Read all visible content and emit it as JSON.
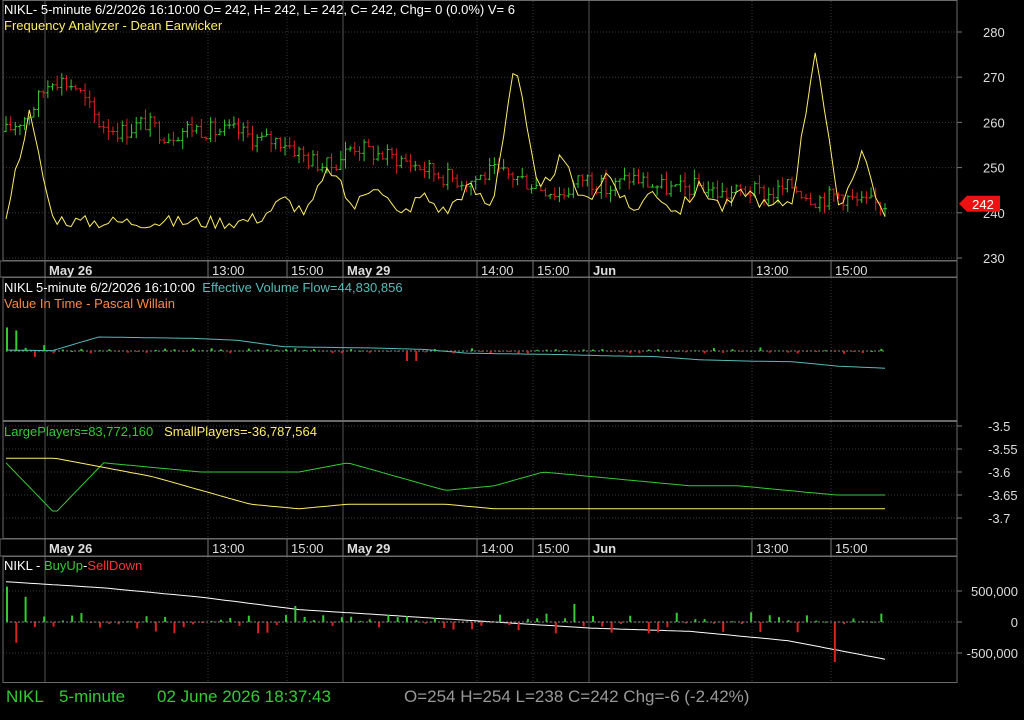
{
  "colors": {
    "grid": "#3a3a3a",
    "frame": "#6a6a6a",
    "up": "#33cc33",
    "down": "#dd2222",
    "yellow": "#ffee66",
    "teal": "#55bbbb",
    "orange": "#ff8844",
    "white": "#ffffff",
    "price_tag": "#ee1111"
  },
  "panel1": {
    "header": "NIKL- 5-minute 6/2/2026 16:10:00 O= 242, H= 242, L= 242, C= 242, Chg= 0 (0.0%) V= 6",
    "indicator": "Frequency Analyzer - Dean Earwicker",
    "y_ticks": [
      "280",
      "270",
      "260",
      "250",
      "240",
      "230"
    ],
    "price_tag": "242"
  },
  "time_axis": {
    "labels": [
      "May 26",
      "13:00",
      "15:00",
      "May 29",
      "14:00",
      "15:00",
      "Jun",
      "13:00",
      "15:00"
    ]
  },
  "panel2": {
    "header": "NIKL 5-minute  6/2/2026 16:10:00",
    "indicator": "Effective Volume Flow=44,830,856",
    "subtitle": "Value In Time - Pascal Willain"
  },
  "panel3": {
    "large_label": "LargePlayers=83,772,160",
    "small_label": "SmallPlayers=-36,787,564",
    "y_ticks": [
      "-3.5",
      "-3.55",
      "-3.6",
      "-3.65",
      "-3.7"
    ]
  },
  "panel4": {
    "symbol": "NIKL -",
    "buy": "BuyUp",
    "dash": "-",
    "sell": "SellDown",
    "y_ticks": [
      "500,000",
      "0",
      "-500,000"
    ]
  },
  "status_bar": {
    "symbol": "NIKL",
    "interval": "5-minute",
    "datetime": "02 June 2026 18:37:43",
    "ohlc": "O=254  H=254  L=238  C=242  Chg=-6 (-2.42%)"
  },
  "chart_data": [
    {
      "type": "line",
      "title": "NIKL 5-minute",
      "ylim": [
        225,
        290
      ],
      "y_ticks": [
        280,
        270,
        260,
        250,
        240,
        230
      ],
      "x_labels": [
        "May 26",
        "13:00",
        "15:00",
        "May 29",
        "14:00",
        "15:00",
        "Jun",
        "13:00",
        "15:00"
      ],
      "series": [
        {
          "name": "NIKL",
          "kind": "ohlc-bars",
          "close_values": [
            258,
            262,
            270,
            268,
            260,
            258,
            260,
            257,
            259,
            258,
            258,
            256,
            256,
            252,
            250,
            255,
            253,
            252,
            250,
            248,
            247,
            249,
            248,
            246,
            244,
            248,
            245,
            248,
            246,
            245,
            246,
            244,
            245,
            244,
            246,
            243,
            244,
            242,
            242
          ]
        },
        {
          "name": "Frequency Analyzer",
          "values": [
            240,
            262,
            239,
            238,
            238,
            238,
            238,
            238,
            238,
            238,
            238,
            239,
            243,
            240,
            250,
            241,
            247,
            239,
            244,
            240,
            246,
            241,
            274,
            244,
            252,
            242,
            249,
            240,
            245,
            240,
            246,
            241,
            245,
            241,
            243,
            277,
            240,
            254,
            238
          ]
        }
      ]
    },
    {
      "type": "line",
      "title": "Effective Volume Flow",
      "series": [
        {
          "name": "Effective Volume Flow",
          "values": [
            44.5,
            44.4,
            46.5,
            46.4,
            46.3,
            46.0,
            45.0,
            44.9,
            44.8,
            44.6,
            44.0,
            43.9,
            43.8,
            43.6,
            43.5,
            43.0,
            42.8,
            42.7,
            42.0,
            41.7
          ]
        },
        {
          "name": "Value In Time",
          "kind": "histogram",
          "values": [
            1,
            -3,
            3,
            2,
            0,
            0,
            0,
            0,
            -1,
            0,
            0,
            -1,
            1,
            0,
            -1,
            0,
            0,
            1,
            -1,
            0
          ]
        }
      ]
    },
    {
      "type": "line",
      "series": [
        {
          "name": "LargePlayers",
          "values": [
            -3.58,
            -3.69,
            -3.58,
            -3.59,
            -3.6,
            -3.6,
            -3.6,
            -3.58,
            -3.61,
            -3.64,
            -3.63,
            -3.6,
            -3.61,
            -3.62,
            -3.63,
            -3.63,
            -3.64,
            -3.65,
            -3.65
          ]
        },
        {
          "name": "SmallPlayers",
          "values": [
            -3.57,
            -3.57,
            -3.59,
            -3.61,
            -3.64,
            -3.67,
            -3.68,
            -3.67,
            -3.67,
            -3.67,
            -3.68,
            -3.68,
            -3.68,
            -3.68,
            -3.68,
            -3.68,
            -3.68,
            -3.68,
            -3.68
          ]
        }
      ],
      "y_ticks": [
        -3.5,
        -3.55,
        -3.6,
        -3.65,
        -3.7
      ]
    },
    {
      "type": "bar",
      "y_ticks": [
        500000,
        0,
        -500000
      ],
      "series": [
        {
          "name": "BuyUp",
          "values": [
            650000,
            550000,
            400000,
            200000,
            100000,
            0,
            -100000,
            -150000,
            -300000,
            -600000
          ]
        },
        {
          "name": "SellDown",
          "kind": "histogram",
          "values": [
            -300000,
            400000,
            -100000,
            50000,
            150000,
            -150000,
            100000,
            -50000,
            80000,
            -500000
          ]
        }
      ]
    }
  ]
}
